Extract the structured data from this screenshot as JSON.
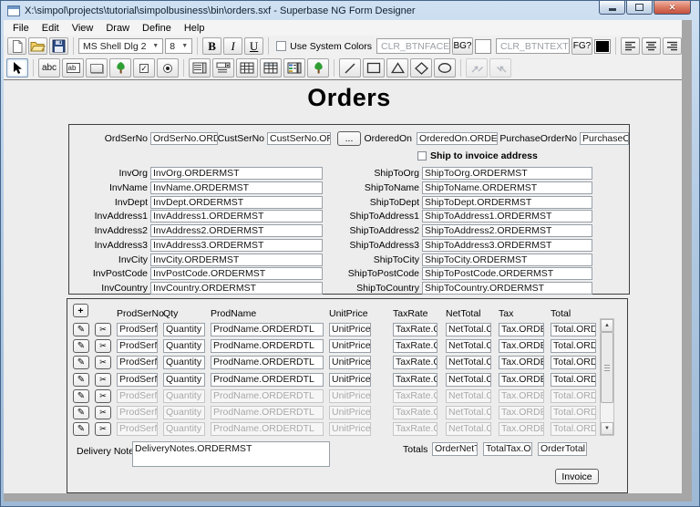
{
  "window": {
    "title": "X:\\simpol\\projects\\tutorial\\simpolbusiness\\bin\\orders.sxf - Superbase NG Form Designer"
  },
  "icons": {
    "close": "✕",
    "dropdown": "▼",
    "up": "▲",
    "down": "▼",
    "pencil": "✎",
    "scissors": "✂",
    "check": "✓"
  },
  "menu": {
    "items": [
      "File",
      "Edit",
      "View",
      "Draw",
      "Define",
      "Help"
    ]
  },
  "toolbar": {
    "font": "MS Shell Dlg 2",
    "size": "8",
    "bold": "B",
    "italic": "I",
    "underline": "U",
    "use_system_colors": "Use System Colors",
    "bg_color": "CLR_BTNFACE",
    "bg_button": "BG?",
    "fg_color": "CLR_BTNTEXT",
    "fg_button": "FG?",
    "bg_swatch": "#ffffff",
    "fg_swatch": "#000000"
  },
  "tools": {
    "abc": "abc",
    "ab": "ab",
    "names": [
      "pointer",
      "label",
      "text-field",
      "push-button",
      "image",
      "check-box",
      "radio-button",
      "list-box",
      "combo-box",
      "grid",
      "table",
      "detail-block",
      "image",
      "line",
      "rectangle",
      "triangle",
      "diamond",
      "ellipse",
      "link-source",
      "link-target"
    ]
  },
  "form": {
    "title": "Orders",
    "header": {
      "ordserno_label": "OrdSerNo",
      "ordserno_value": "OrdSerNo.ORDE",
      "custserno_label": "CustSerNo",
      "custserno_value": "CustSerNo.ORD",
      "browse_button": "...",
      "orderedon_label": "OrderedOn",
      "orderedon_value": "OrderedOn.ORDERI",
      "po_label": "PurchaseOrderNo",
      "po_value": "PurchaseOrderNo.O",
      "ship_checkbox": "Ship to invoice address"
    },
    "inv_fields": [
      {
        "label": "InvOrg",
        "value": "InvOrg.ORDERMST"
      },
      {
        "label": "InvName",
        "value": "InvName.ORDERMST"
      },
      {
        "label": "InvDept",
        "value": "InvDept.ORDERMST"
      },
      {
        "label": "InvAddress1",
        "value": "InvAddress1.ORDERMST"
      },
      {
        "label": "InvAddress2",
        "value": "InvAddress2.ORDERMST"
      },
      {
        "label": "InvAddress3",
        "value": "InvAddress3.ORDERMST"
      },
      {
        "label": "InvCity",
        "value": "InvCity.ORDERMST"
      },
      {
        "label": "InvPostCode",
        "value": "InvPostCode.ORDERMST"
      },
      {
        "label": "InvCountry",
        "value": "InvCountry.ORDERMST"
      }
    ],
    "ship_fields": [
      {
        "label": "ShipToOrg",
        "value": "ShipToOrg.ORDERMST"
      },
      {
        "label": "ShipToName",
        "value": "ShipToName.ORDERMST"
      },
      {
        "label": "ShipToDept",
        "value": "ShipToDept.ORDERMST"
      },
      {
        "label": "ShipToAddress1",
        "value": "ShipToAddress1.ORDERMST"
      },
      {
        "label": "ShipToAddress2",
        "value": "ShipToAddress2.ORDERMST"
      },
      {
        "label": "ShipToAddress3",
        "value": "ShipToAddress3.ORDERMST"
      },
      {
        "label": "ShipToCity",
        "value": "ShipToCity.ORDERMST"
      },
      {
        "label": "ShipToPostCode",
        "value": "ShipToPostCode.ORDERMST"
      },
      {
        "label": "ShipToCountry",
        "value": "ShipToCountry.ORDERMST"
      }
    ]
  },
  "grid": {
    "add_button": "+",
    "headers": [
      "ProdSerNo",
      "Qty",
      "ProdName",
      "UnitPrice",
      "TaxRate",
      "NetTotal",
      "Tax",
      "Total"
    ],
    "row": {
      "prodserno": "ProdSerN",
      "qty": "Quantity",
      "prodname": "ProdName.ORDERDTL",
      "unitprice": "UnitPrice.ORD",
      "taxrate": "TaxRate.ORD",
      "nettotal": "NetTotal.ORD",
      "tax": "Tax.ORDERD",
      "total": "Total.ORDERI"
    }
  },
  "footer": {
    "delivery_notes_label": "Delivery Notes",
    "delivery_notes_value": "DeliveryNotes.ORDERMST",
    "totals_label": "Totals",
    "net_total": "OrderNetTota",
    "total_tax": "TotalTax.ORD",
    "order_total": "OrderTotal.O",
    "invoice_button": "Invoice"
  }
}
